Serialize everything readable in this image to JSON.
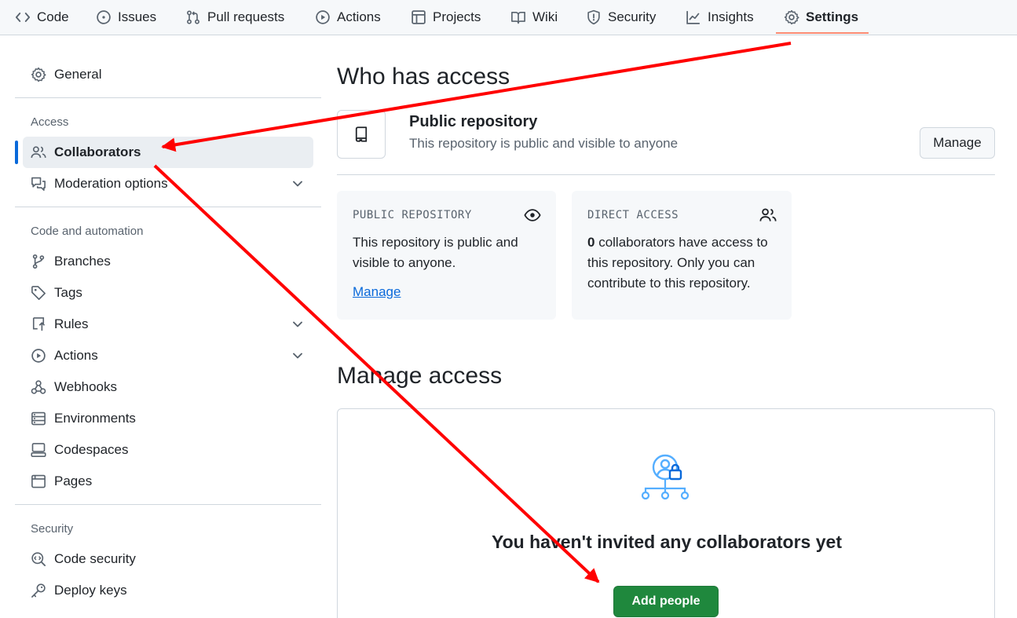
{
  "repo_nav": {
    "tabs": [
      {
        "label": "Code",
        "icon": "code-icon"
      },
      {
        "label": "Issues",
        "icon": "issue-circle-icon"
      },
      {
        "label": "Pull requests",
        "icon": "pull-request-icon"
      },
      {
        "label": "Actions",
        "icon": "play-icon"
      },
      {
        "label": "Projects",
        "icon": "table-icon"
      },
      {
        "label": "Wiki",
        "icon": "book-icon"
      },
      {
        "label": "Security",
        "icon": "shield-icon"
      },
      {
        "label": "Insights",
        "icon": "graph-icon"
      },
      {
        "label": "Settings",
        "icon": "gear-icon",
        "active": true
      }
    ]
  },
  "sidebar": {
    "general": "General",
    "access_heading": "Access",
    "collaborators": "Collaborators",
    "moderation": "Moderation options",
    "code_heading": "Code and automation",
    "branches": "Branches",
    "tags": "Tags",
    "rules": "Rules",
    "actions": "Actions",
    "webhooks": "Webhooks",
    "environments": "Environments",
    "codespaces": "Codespaces",
    "pages": "Pages",
    "security_heading": "Security",
    "code_security": "Code security",
    "deploy_keys": "Deploy keys"
  },
  "main": {
    "who_title": "Who has access",
    "public_title": "Public repository",
    "public_sub": "This repository is public and visible to anyone",
    "manage_button": "Manage",
    "card_public": {
      "label": "PUBLIC REPOSITORY",
      "text": "This repository is public and visible to anyone.",
      "link": "Manage"
    },
    "card_direct": {
      "label": "DIRECT ACCESS",
      "count": "0",
      "text": " collaborators have access to this repository. Only you can contribute to this repository."
    },
    "manage_title": "Manage access",
    "empty_title": "You haven't invited any collaborators yet",
    "add_button": "Add people"
  },
  "colors": {
    "accent_blue": "#0969da",
    "primary_green": "#1f883d",
    "annotation_red": "#ff0000",
    "tab_underline": "#fd8c73"
  }
}
